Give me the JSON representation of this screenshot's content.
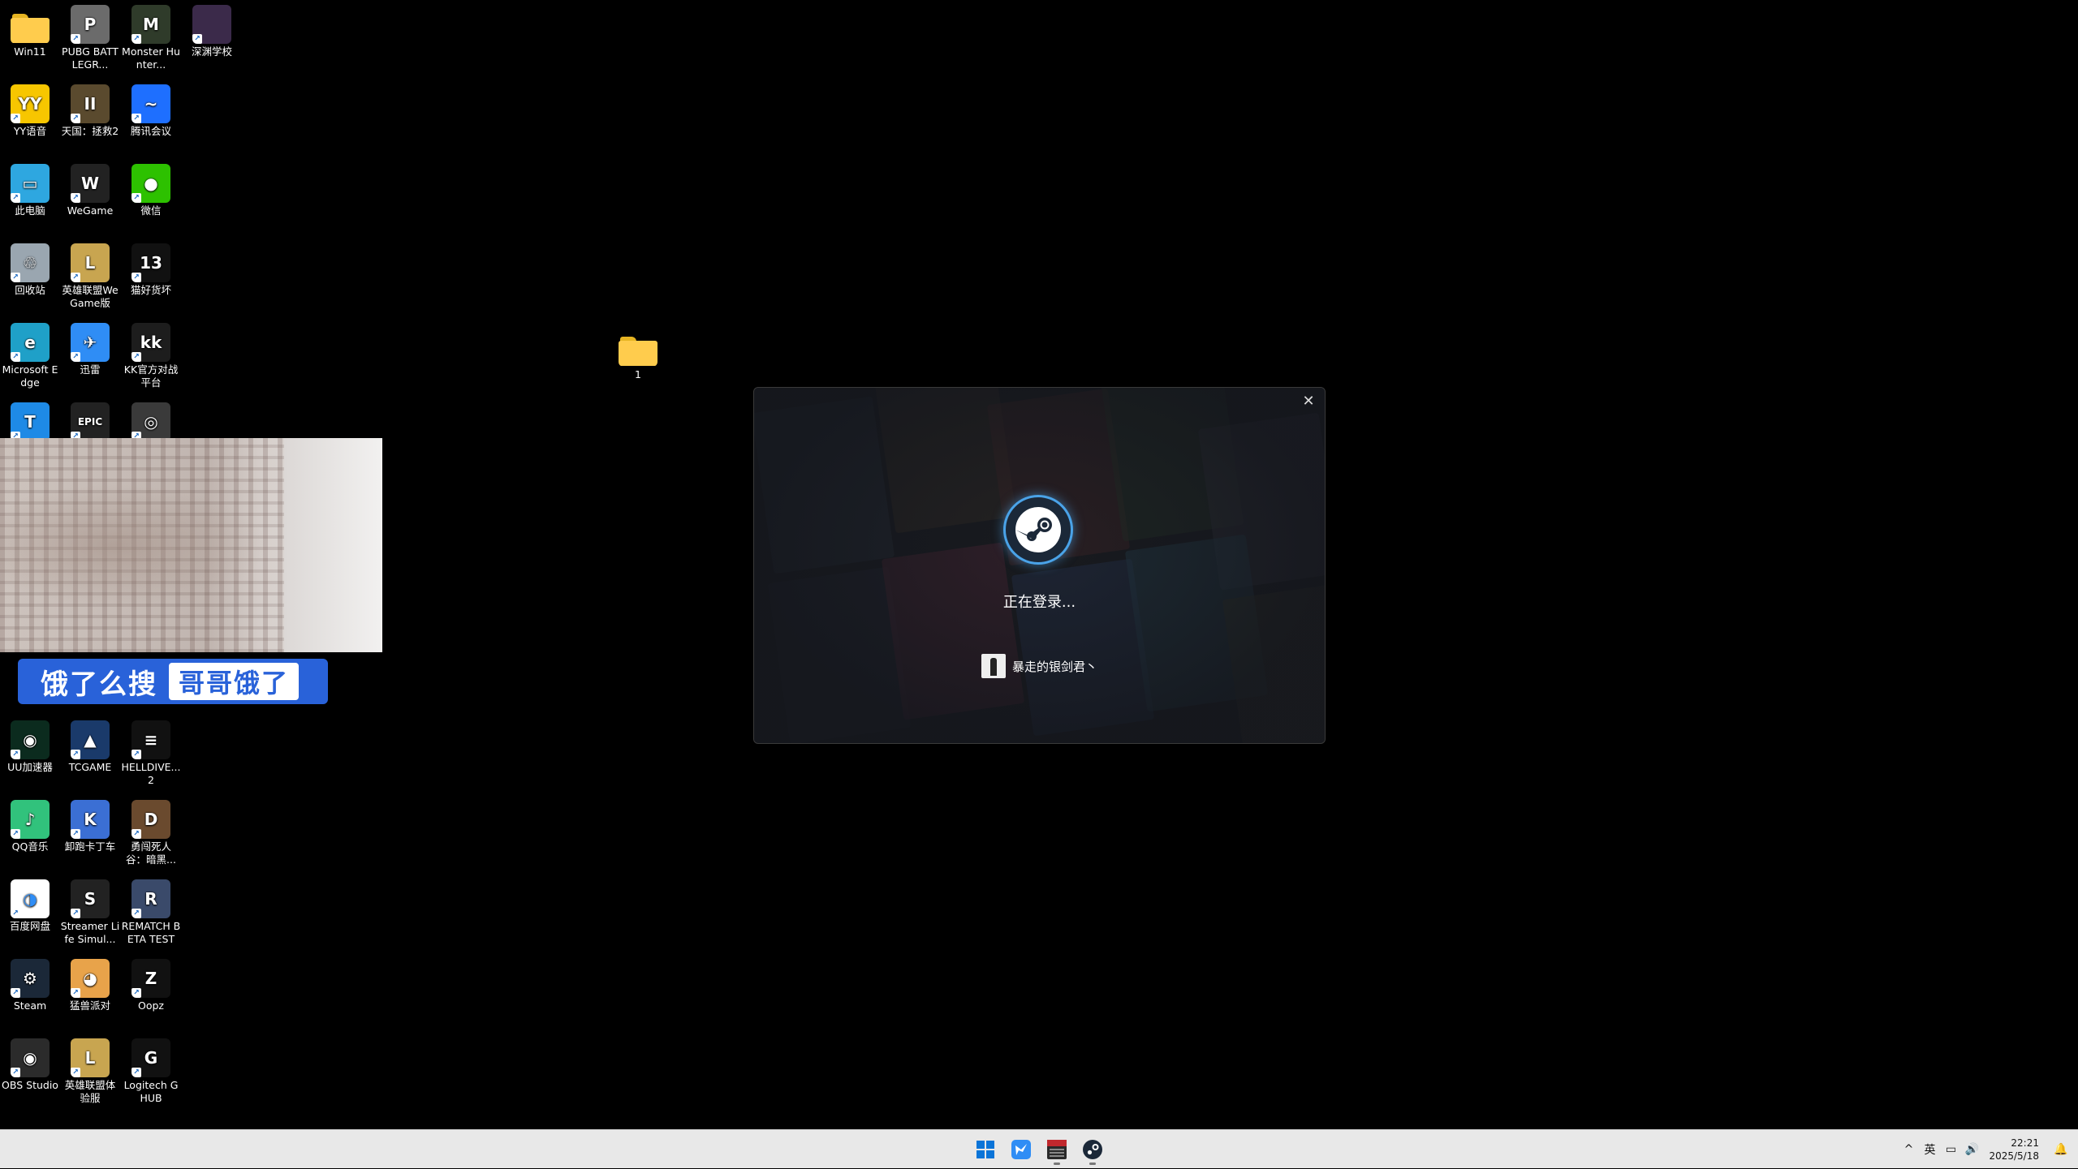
{
  "desktop_icons": [
    {
      "label": "Win11",
      "icon": "folder-icon",
      "color": "#ffcc4d"
    },
    {
      "label": "PUBG BATTLEGR...",
      "icon": "pubg-icon",
      "color": "#6b6b6b"
    },
    {
      "label": "Monster Hunter...",
      "icon": "monster-hunter-icon",
      "color": "#2f3b2a"
    },
    {
      "label": "深渊学校",
      "icon": "game-cover-icon",
      "color": "#3b2a4a"
    },
    {
      "label": "YY语音",
      "icon": "yy-icon",
      "color": "#f7c600"
    },
    {
      "label": "天国：拯救2",
      "icon": "kingdom-come-icon",
      "color": "#5a4a2e"
    },
    {
      "label": "腾讯会议",
      "icon": "tencent-meeting-icon",
      "color": "#1e6fff"
    },
    {
      "label": "此电脑",
      "icon": "computer-icon",
      "color": "#2ea7e0"
    },
    {
      "label": "WeGame",
      "icon": "wegame-icon",
      "color": "#222222"
    },
    {
      "label": "微信",
      "icon": "wechat-icon",
      "color": "#2dc100"
    },
    {
      "label": "回收站",
      "icon": "recycle-bin-icon",
      "color": "#9aa6b0"
    },
    {
      "label": "英雄联盟WeGame版",
      "icon": "league-icon",
      "color": "#c8a550"
    },
    {
      "label": "猫好货坏",
      "icon": "game-13-icon",
      "color": "#111111"
    },
    {
      "label": "Microsoft Edge",
      "icon": "edge-icon",
      "color": "#1fa0c8"
    },
    {
      "label": "迅雷",
      "icon": "thunder-icon",
      "color": "#2f8df5"
    },
    {
      "label": "KK官方对战平台",
      "icon": "kk-icon",
      "color": "#1d1d1d"
    },
    {
      "label": "",
      "icon": "app-icon-cut",
      "color": "#1e8ae6"
    },
    {
      "label": "",
      "icon": "epic-games-icon",
      "color": "#222222"
    },
    {
      "label": "",
      "icon": "game-badge-icon",
      "color": "#3a3a3a"
    },
    {
      "label": "UU加速器",
      "icon": "uu-icon",
      "color": "#0b2b1e"
    },
    {
      "label": "TCGAME",
      "icon": "tcgame-icon",
      "color": "#1a3a6a"
    },
    {
      "label": "HELLDIVE... 2",
      "icon": "helldivers-icon",
      "color": "#111111"
    },
    {
      "label": "QQ音乐",
      "icon": "qq-music-icon",
      "color": "#31c27c"
    },
    {
      "label": "卸跑卡丁车",
      "icon": "kart-icon",
      "color": "#3b6fd4"
    },
    {
      "label": "勇闯死人谷：暗黑...",
      "icon": "dead-valley-icon",
      "color": "#6a4a2e"
    },
    {
      "label": "百度网盘",
      "icon": "baidu-pan-icon",
      "color": "#ffffff"
    },
    {
      "label": "Streamer Life Simul...",
      "icon": "streamer-life-icon",
      "color": "#222222"
    },
    {
      "label": "REMATCH BETA TEST",
      "icon": "rematch-icon",
      "color": "#3a4a6a"
    },
    {
      "label": "Steam",
      "icon": "steam-icon",
      "color": "#1b2838"
    },
    {
      "label": "猛兽派对",
      "icon": "party-animals-icon",
      "color": "#e8a34a"
    },
    {
      "label": "Oopz",
      "icon": "oopz-icon",
      "color": "#111111"
    },
    {
      "label": "OBS Studio",
      "icon": "obs-icon",
      "color": "#2b2b2b"
    },
    {
      "label": "英雄联盟体验服",
      "icon": "league-pbe-icon",
      "color": "#c8a550"
    },
    {
      "label": "Logitech G HUB",
      "icon": "logitech-icon",
      "color": "#111111"
    }
  ],
  "desktop_folder": {
    "label": "1",
    "icon": "folder-icon"
  },
  "webcam_overlay": {
    "banner_text": "饿了么搜",
    "banner_highlight": "哥哥饿了"
  },
  "steam_login": {
    "status": "正在登录...",
    "username": "暴走的银剑君丶",
    "close_label": "✕"
  },
  "taskbar": {
    "pinned": [
      {
        "name": "start-button",
        "icon": "windows-icon"
      },
      {
        "name": "taskbar-thunder",
        "icon": "thunder-icon"
      },
      {
        "name": "taskbar-voicemeeter",
        "icon": "voicemeeter-icon"
      },
      {
        "name": "taskbar-steam",
        "icon": "steam-icon"
      }
    ],
    "tray": {
      "chevron": "^",
      "ime": "英",
      "network": "▭",
      "volume": "🔊",
      "time": "22:21",
      "date": "2025/5/18",
      "notification": "🔔"
    }
  },
  "colors": {
    "steam_blue": "#4aa3e8",
    "taskbar_bg": "#e8e8e8",
    "banner_blue": "#2962d9"
  }
}
